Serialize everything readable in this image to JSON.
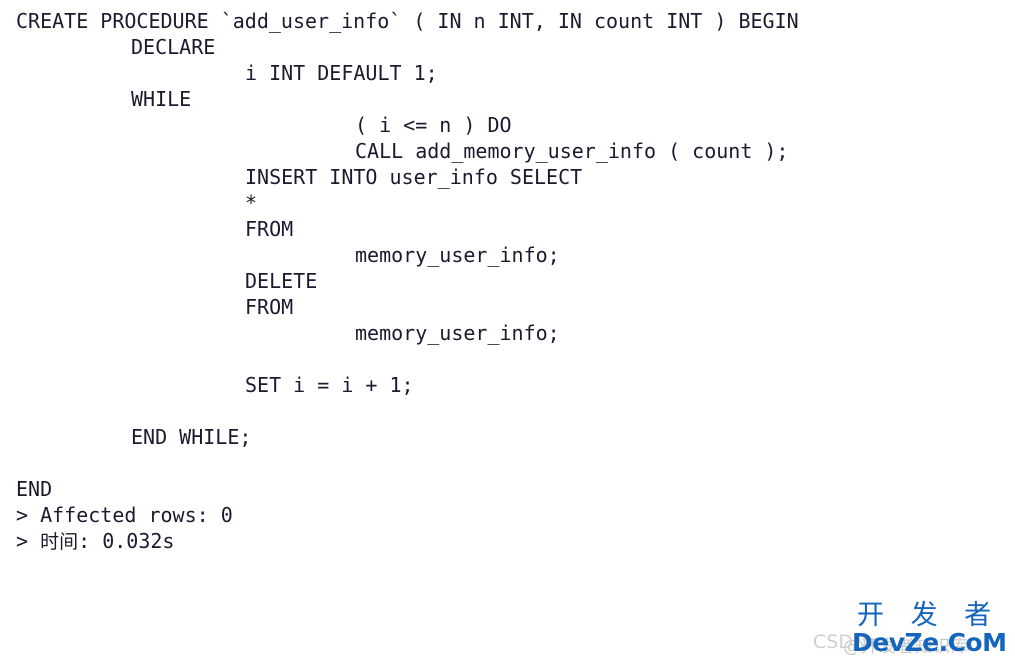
{
  "editor": {
    "background_color": "#ffffff",
    "text_color": "#1b1b2f",
    "code_lines": [
      {
        "indent": 0,
        "text": "CREATE PROCEDURE `add_user_info` ( IN n INT, IN count INT ) BEGIN"
      },
      {
        "indent": 1,
        "text": "DECLARE"
      },
      {
        "indent": 2,
        "text": "i INT DEFAULT 1;"
      },
      {
        "indent": 1,
        "text": "WHILE"
      },
      {
        "indent": 3,
        "text": "( i <= n ) DO"
      },
      {
        "indent": 3,
        "text": "CALL add_memory_user_info ( count );"
      },
      {
        "indent": 2,
        "text": "INSERT INTO user_info SELECT"
      },
      {
        "indent": 2,
        "text": "*"
      },
      {
        "indent": 2,
        "text": "FROM"
      },
      {
        "indent": 3,
        "text": "memory_user_info;"
      },
      {
        "indent": 2,
        "text": "DELETE"
      },
      {
        "indent": 2,
        "text": "FROM"
      },
      {
        "indent": 3,
        "text": "memory_user_info;"
      },
      {
        "indent": 0,
        "text": ""
      },
      {
        "indent": 2,
        "text": "SET i = i + 1;"
      },
      {
        "indent": 0,
        "text": ""
      },
      {
        "indent": 1,
        "text": "END WHILE;"
      },
      {
        "indent": 0,
        "text": ""
      },
      {
        "indent": 0,
        "text": "END"
      }
    ]
  },
  "results": {
    "affected_rows_line": "> Affected rows: 0",
    "time_prompt": "> ",
    "time_label": "时间",
    "time_value": ": 0.032s"
  },
  "watermark": {
    "chinese_title": "开 发 者",
    "domain": "DevZe.CoM",
    "csdn_text": "CSDN",
    "ghost_chinese": "@开发者知识库",
    "blue": "#1565bd",
    "gray": "#cfcfcf"
  }
}
